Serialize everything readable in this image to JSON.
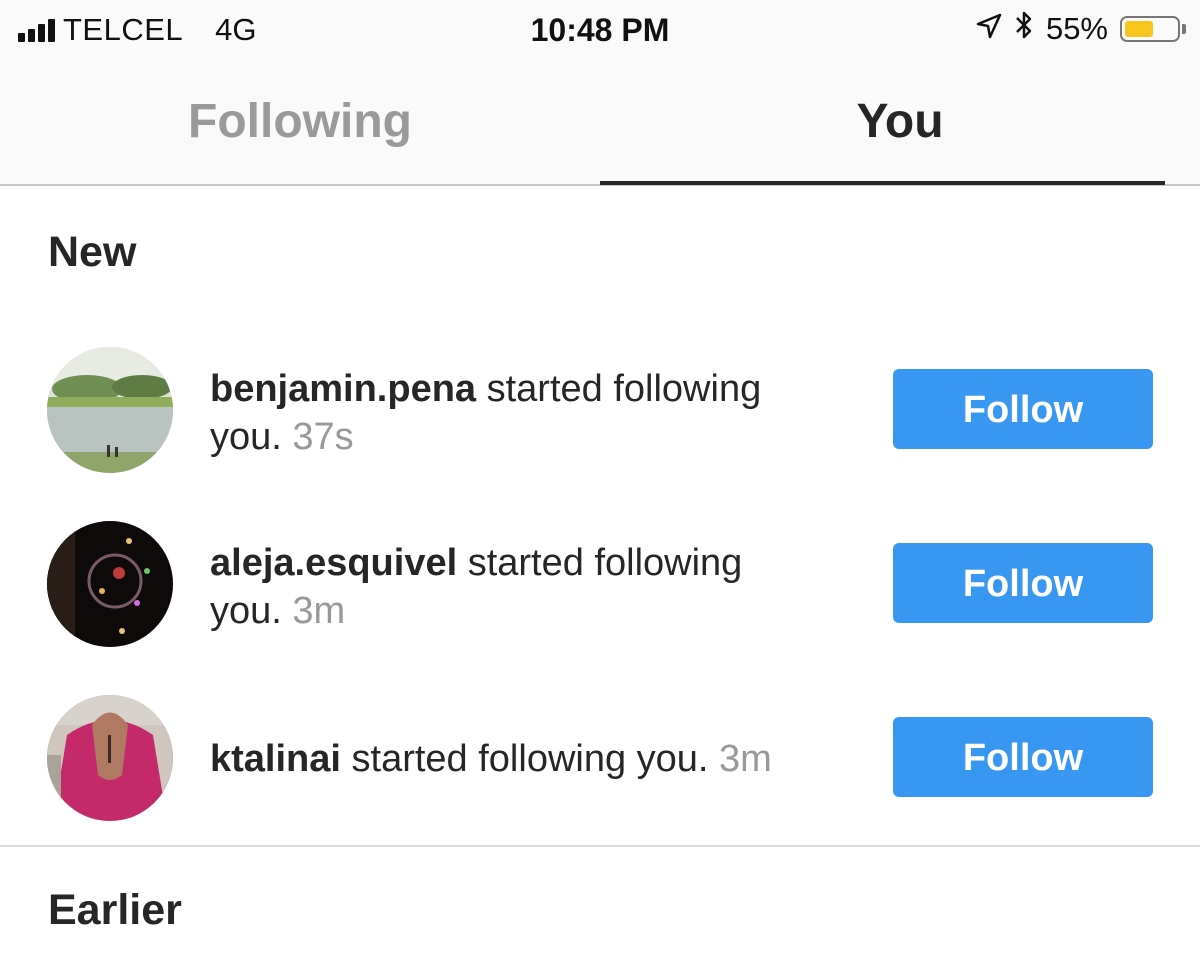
{
  "status_bar": {
    "carrier": "TELCEL",
    "network": "4G",
    "time": "10:48 PM",
    "battery_percent": "55%",
    "battery_level": 0.55,
    "battery_color": "#f7c51c",
    "icons": [
      "signal-icon",
      "location-arrow-icon",
      "bluetooth-icon",
      "battery-icon"
    ]
  },
  "tabs": [
    {
      "label": "Following",
      "active": false
    },
    {
      "label": "You",
      "active": true
    }
  ],
  "sections": {
    "new_title": "New",
    "earlier_title": "Earlier"
  },
  "notifications": [
    {
      "username": "benjamin.pena",
      "action_line1": " started following",
      "action_line2": "you.",
      "time": "37s",
      "button": "Follow"
    },
    {
      "username": "aleja.esquivel",
      "action_line1": " started following",
      "action_line2": "you.",
      "time": "3m",
      "button": "Follow"
    },
    {
      "username": "ktalinai",
      "action": " started following you.",
      "time": "3m",
      "button": "Follow"
    }
  ],
  "colors": {
    "follow_button": "#3897f0",
    "active_tab": "#262626",
    "inactive_tab": "#9a9a9a",
    "timestamp": "#999999"
  }
}
